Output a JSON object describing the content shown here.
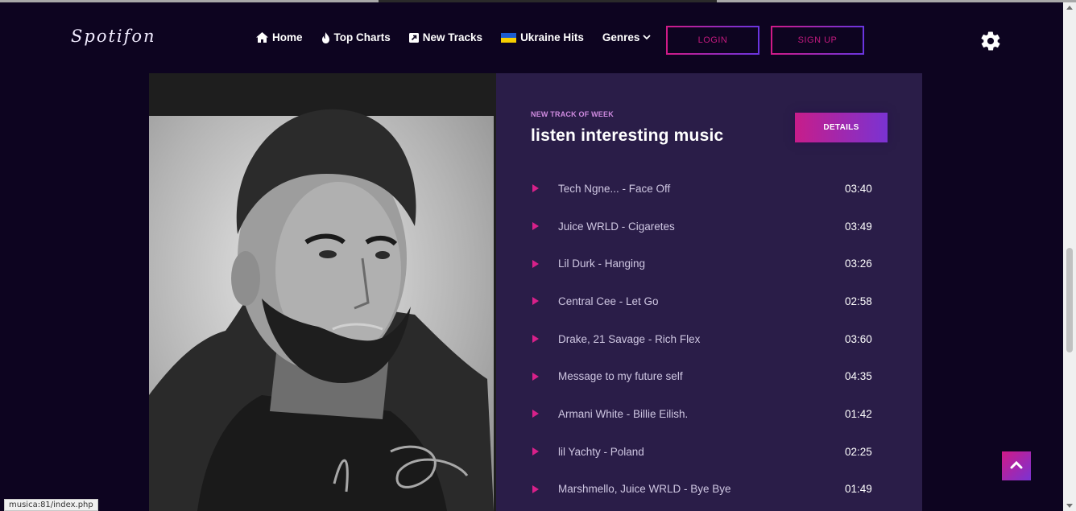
{
  "brand": {
    "logo": "Spotifon"
  },
  "nav": {
    "home": "Home",
    "top_charts": "Top Charts",
    "new_tracks": "New Tracks",
    "ukraine_hits": "Ukraine Hits",
    "genres": "Genres",
    "login": "LOGIN",
    "signup": "SIGN UP"
  },
  "feature": {
    "eyebrow": "NEW TRACK OF WEEK",
    "headline": "listen interesting music",
    "details_label": "DETAILS"
  },
  "tracks": [
    {
      "name": "Tech Ngne... - Face Off",
      "duration": "03:40"
    },
    {
      "name": "Juice WRLD - Cigaretes",
      "duration": "03:49"
    },
    {
      "name": "Lil Durk - Hanging",
      "duration": "03:26"
    },
    {
      "name": "Central Cee - Let Go",
      "duration": "02:58"
    },
    {
      "name": "Drake, 21 Savage - Rich Flex",
      "duration": "03:60"
    },
    {
      "name": "Message to my future self",
      "duration": "04:35"
    },
    {
      "name": "Armani White - Billie Eilish.",
      "duration": "01:42"
    },
    {
      "name": "lil Yachty - Poland",
      "duration": "02:25"
    },
    {
      "name": "Marshmello, Juice WRLD - Bye Bye",
      "duration": "01:49"
    }
  ],
  "status_bar": {
    "url": "musica:81/index.php"
  },
  "colors": {
    "background": "#0d0420",
    "panel": "#2a1d48",
    "accent_pink": "#d01a87",
    "accent_purple": "#7a33d2"
  },
  "icons": {
    "home": "home-icon",
    "top_charts": "fire-icon",
    "new_tracks": "square-arrow-icon",
    "ukraine_hits": "ukraine-flag-icon",
    "genres": "chevron-down-icon",
    "settings": "gear-icon",
    "scroll_top": "chevron-up-icon",
    "play": "play-icon"
  }
}
